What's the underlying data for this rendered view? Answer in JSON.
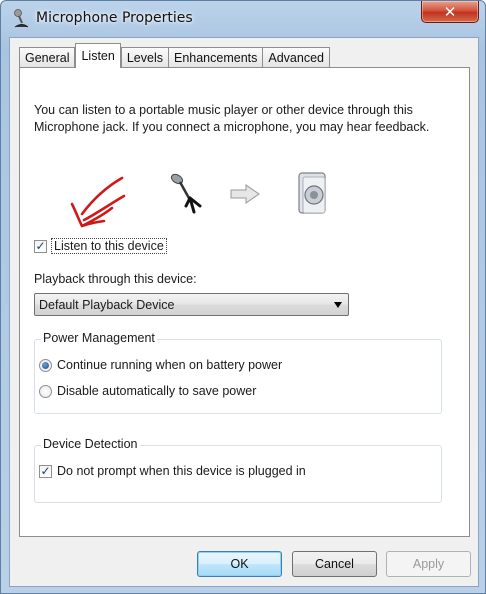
{
  "window": {
    "title": "Microphone Properties",
    "close_label": "✕"
  },
  "tabs": [
    {
      "label": "General",
      "active": false
    },
    {
      "label": "Listen",
      "active": true
    },
    {
      "label": "Levels",
      "active": false
    },
    {
      "label": "Enhancements",
      "active": false
    },
    {
      "label": "Advanced",
      "active": false
    }
  ],
  "listen": {
    "intro": "You can listen to a portable music player or other device through this Microphone jack.  If you connect a microphone, you may hear feedback.",
    "listen_checkbox": {
      "label": "Listen to this device",
      "checked": true
    },
    "playback_label": "Playback through this device:",
    "playback_device": "Default Playback Device",
    "power": {
      "title": "Power Management",
      "options": [
        {
          "label": "Continue running when on battery power",
          "selected": true
        },
        {
          "label": "Disable automatically to save power",
          "selected": false
        }
      ]
    },
    "detection": {
      "title": "Device Detection",
      "checkbox": {
        "label": "Do not prompt when this device is plugged in",
        "checked": true
      }
    }
  },
  "buttons": {
    "ok": "OK",
    "cancel": "Cancel",
    "apply": "Apply"
  },
  "colors": {
    "annotation_red": "#d01818",
    "title_bar": "#b9d0e8",
    "close_red": "#c0321d"
  },
  "icons": [
    "microphone-properties-icon",
    "close-icon",
    "microphone-icon",
    "arrow-right-icon",
    "speaker-icon",
    "red-annotation-arrow"
  ]
}
